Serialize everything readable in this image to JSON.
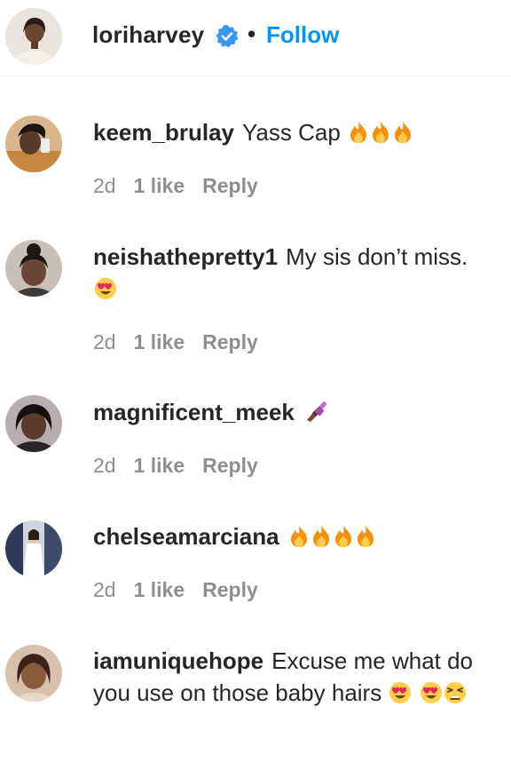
{
  "post_header": {
    "username": "loriharvey",
    "separator": "•",
    "follow_label": "Follow",
    "accent_color": "#0095f6"
  },
  "comments": [
    {
      "username": "keem_brulay",
      "text": "Yass Cap",
      "emojis": [
        "fire-emoji",
        "fire-emoji",
        "fire-emoji"
      ],
      "time": "2d",
      "likes": "1 like",
      "reply": "Reply"
    },
    {
      "username": "neishathepretty1",
      "text": "My sis don’t miss.",
      "emojis": [
        "heart-eyes-emoji"
      ],
      "time": "2d",
      "likes": "1 like",
      "reply": "Reply"
    },
    {
      "username": "magnificent_meek",
      "text": "",
      "emojis": [
        "nail-polish-emoji"
      ],
      "time": "2d",
      "likes": "1 like",
      "reply": "Reply"
    },
    {
      "username": "chelseamarciana",
      "text": "",
      "emojis": [
        "fire-emoji",
        "fire-emoji",
        "fire-emoji",
        "fire-emoji"
      ],
      "time": "2d",
      "likes": "1 like",
      "reply": "Reply"
    },
    {
      "username": "iamuniquehope",
      "text": "Excuse me what do you use on those baby hairs",
      "emojis": [
        "heart-eyes-emoji",
        "heart-eyes-emoji",
        "tired-face-emoji"
      ],
      "time": "",
      "likes": "",
      "reply": ""
    }
  ]
}
